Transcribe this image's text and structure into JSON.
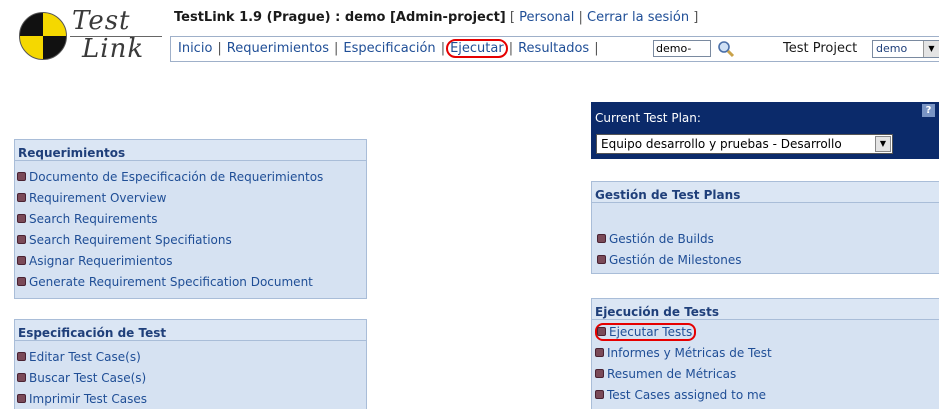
{
  "logo": {
    "line1": "Test",
    "line2": "Link"
  },
  "header": {
    "title": "TestLink 1.9 (Prague) : demo [Admin-project]",
    "personal_link": "Personal",
    "logout_link": "Cerrar la sesión"
  },
  "nav": {
    "items": [
      "Inicio",
      "Requerimientos",
      "Especificación",
      "Ejecutar",
      "Resultados"
    ],
    "search_value": "demo-",
    "search_icon": "magnifier-icon",
    "test_project_label": "Test Project",
    "test_project_value": "demo"
  },
  "requirements_panel": {
    "title": "Requerimientos",
    "items": [
      "Documento de Especificación de Requerimientos",
      "Requirement Overview",
      "Search Requirements",
      "Search Requirement Specifiations",
      "Asignar Requerimientos",
      "Generate Requirement Specification Document"
    ]
  },
  "spec_panel": {
    "title": "Especificación de Test",
    "items": [
      "Editar Test Case(s)",
      "Buscar Test Case(s)",
      "Imprimir Test Cases"
    ]
  },
  "current_plan": {
    "label": "Current Test Plan:",
    "help": "?",
    "selected": "Equipo desarrollo y pruebas - Desarrollo"
  },
  "gestion_panel": {
    "title": "Gestión de Test Plans",
    "items": [
      "Gestión de Builds",
      "Gestión de Milestones"
    ]
  },
  "ejec_panel": {
    "title": "Ejecución de Tests",
    "items": [
      "Ejecutar Tests",
      "Informes y Métricas de Test",
      "Resumen de Métricas",
      "Test Cases assigned to me"
    ]
  },
  "colors": {
    "highlight_ring": "#e60000",
    "plan_bg": "#0b2a6a",
    "panel_bg": "#d6e2f2"
  }
}
